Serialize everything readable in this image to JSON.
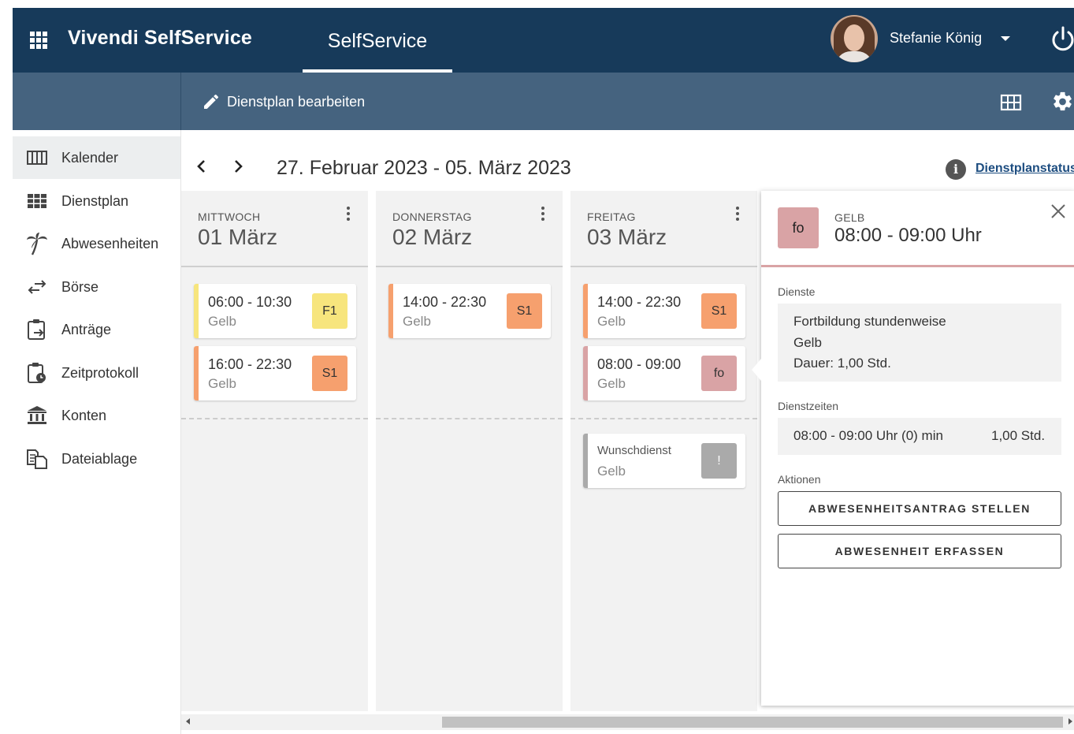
{
  "app": {
    "brand": "Vivendi SelfService",
    "top_tab": "SelfService"
  },
  "user": {
    "name": "Stefanie König"
  },
  "toolbar": {
    "edit_label": "Dienstplan bearbeiten"
  },
  "sidebar": {
    "items": [
      {
        "label": "Kalender",
        "icon": "calendar-icon",
        "active": true
      },
      {
        "label": "Dienstplan",
        "icon": "grid-icon"
      },
      {
        "label": "Abwesenheiten",
        "icon": "palm-tree-icon"
      },
      {
        "label": "Börse",
        "icon": "swap-icon"
      },
      {
        "label": "Anträge",
        "icon": "clipboard-arrow-icon"
      },
      {
        "label": "Zeitprotokoll",
        "icon": "clipboard-clock-icon"
      },
      {
        "label": "Konten",
        "icon": "bank-icon"
      },
      {
        "label": "Dateiablage",
        "icon": "file-icon"
      }
    ]
  },
  "calendar": {
    "range": "27. Februar 2023 - 05. März 2023",
    "status_link": "Dienstplanstatus",
    "days": [
      {
        "weekday": "MITTWOCH",
        "date": "01 März",
        "shifts": [
          {
            "time": "06:00 - 10:30",
            "group": "Gelb",
            "badge": "F1",
            "color": "#f7e57d"
          },
          {
            "time": "16:00 - 22:30",
            "group": "Gelb",
            "badge": "S1",
            "color": "#f6a06e"
          }
        ]
      },
      {
        "weekday": "DONNERSTAG",
        "date": "02 März",
        "shifts": [
          {
            "time": "14:00 - 22:30",
            "group": "Gelb",
            "badge": "S1",
            "color": "#f6a06e"
          }
        ]
      },
      {
        "weekday": "FREITAG",
        "date": "03 März",
        "shifts": [
          {
            "time": "14:00 - 22:30",
            "group": "Gelb",
            "badge": "S1",
            "color": "#f6a06e"
          },
          {
            "time": "08:00 - 09:00",
            "group": "Gelb",
            "badge": "fo",
            "color": "#d9a3a5"
          }
        ],
        "wish": {
          "label": "Wunschdienst",
          "group": "Gelb",
          "badge": "!",
          "color": "#aaaaaa"
        }
      }
    ]
  },
  "detail": {
    "badge": "fo",
    "category": "GELB",
    "time": "08:00 - 09:00 Uhr",
    "section_services": "Dienste",
    "service_name": "Fortbildung stundenweise",
    "service_group": "Gelb",
    "service_duration": "Dauer: 1,00 Std.",
    "section_times": "Dienstzeiten",
    "time_row": "08:00 - 09:00 Uhr (0) min",
    "time_hours": "1,00 Std.",
    "section_actions": "Aktionen",
    "action_1": "ABWESENHEITSANTRAG STELLEN",
    "action_2": "ABWESENHEIT ERFASSEN"
  }
}
